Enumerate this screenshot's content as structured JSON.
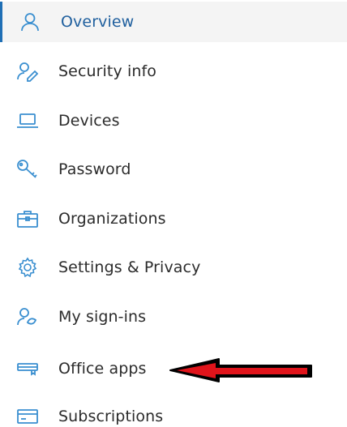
{
  "sidebar": {
    "items": [
      {
        "label": "Overview",
        "icon": "person-icon",
        "active": true
      },
      {
        "label": "Security info",
        "icon": "security-info-icon",
        "active": false
      },
      {
        "label": "Devices",
        "icon": "laptop-icon",
        "active": false
      },
      {
        "label": "Password",
        "icon": "key-icon",
        "active": false
      },
      {
        "label": "Organizations",
        "icon": "briefcase-icon",
        "active": false
      },
      {
        "label": "Settings & Privacy",
        "icon": "gear-icon",
        "active": false
      },
      {
        "label": "My sign-ins",
        "icon": "sign-ins-icon",
        "active": false
      },
      {
        "label": "Office apps",
        "icon": "office-apps-icon",
        "active": false
      },
      {
        "label": "Subscriptions",
        "icon": "subscriptions-icon",
        "active": false
      }
    ]
  },
  "colors": {
    "accent": "#1f6fb5",
    "icon": "#3a8fd0",
    "annotation_arrow_fill": "#e0141b",
    "annotation_arrow_outline": "#000000"
  }
}
